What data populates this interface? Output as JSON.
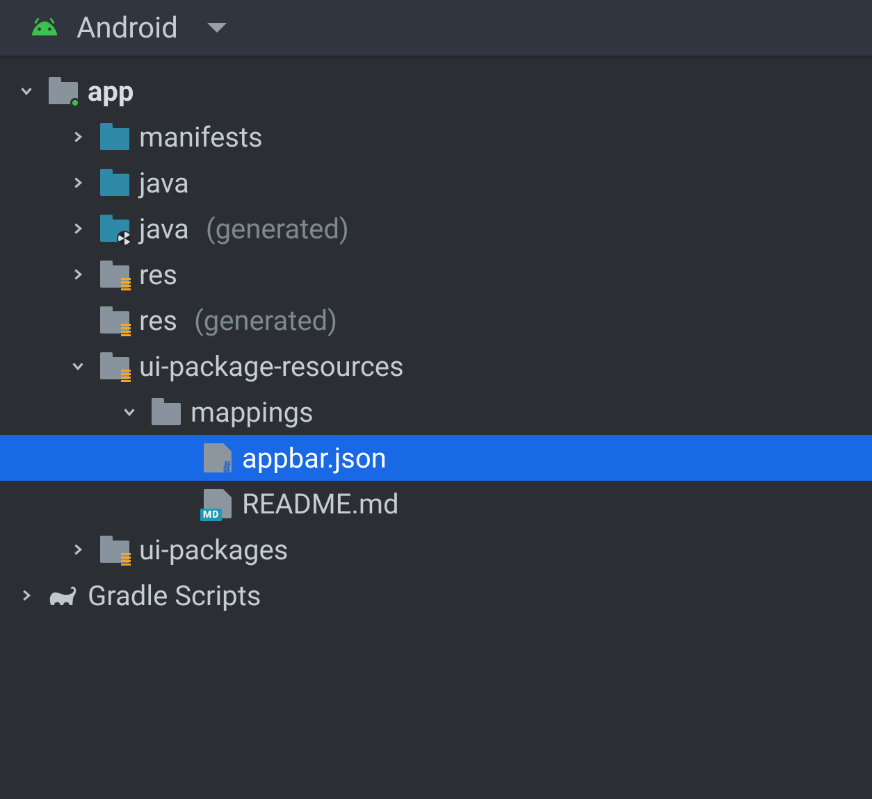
{
  "header": {
    "view_label": "Android"
  },
  "tree": {
    "app": {
      "label": "app"
    },
    "manifests": {
      "label": "manifests"
    },
    "java": {
      "label": "java"
    },
    "java_gen": {
      "label": "java",
      "suffix": "(generated)"
    },
    "res": {
      "label": "res"
    },
    "res_gen": {
      "label": "res",
      "suffix": "(generated)"
    },
    "ui_pkg_res": {
      "label": "ui-package-resources"
    },
    "mappings": {
      "label": "mappings"
    },
    "appbar_json": {
      "label": "appbar.json"
    },
    "readme_md": {
      "label": "README.md"
    },
    "ui_packages": {
      "label": "ui-packages"
    },
    "gradle_scripts": {
      "label": "Gradle Scripts"
    }
  }
}
